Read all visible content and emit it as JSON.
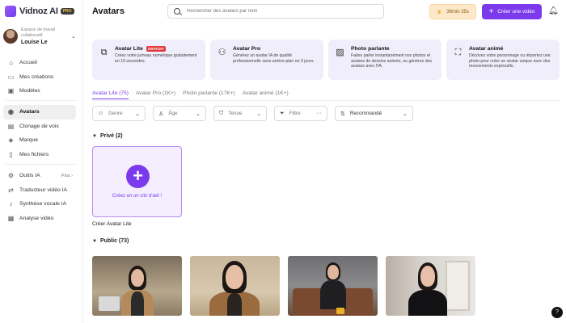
{
  "app": {
    "name": "Vidnoz AI",
    "pro_badge": "PRO"
  },
  "workspace": {
    "label": "Espace de travail collaboratif",
    "user": "Louise Le"
  },
  "sidebar": {
    "items": [
      {
        "label": "Accueil",
        "icon": "home-icon"
      },
      {
        "label": "Mes créations",
        "icon": "folder-icon"
      },
      {
        "label": "Modèles",
        "icon": "template-icon"
      },
      {
        "label": "Avatars",
        "icon": "avatar-icon",
        "active": true
      },
      {
        "label": "Clonage de voix",
        "icon": "voice-icon"
      },
      {
        "label": "Marque",
        "icon": "brand-icon"
      },
      {
        "label": "Mes fichiers",
        "icon": "file-icon"
      },
      {
        "label": "Outils IA",
        "icon": "tools-icon",
        "extra": "Plus"
      },
      {
        "label": "Traducteur vidéo IA",
        "icon": "translate-icon"
      },
      {
        "label": "Synthèse vocale IA",
        "icon": "tts-icon"
      },
      {
        "label": "Analyse vidéo",
        "icon": "analysis-icon"
      }
    ]
  },
  "header": {
    "title": "Avatars",
    "search_placeholder": "Rechercher des avatars par nom",
    "timer": "36min 35s",
    "create_label": "Créer une vidéo"
  },
  "cards": [
    {
      "title": "Avatar Lite",
      "badge": "GRATUIT",
      "desc": "Créez votre jumeau numérique gratuitement en 10 secondes.",
      "icon": "avatar-lite-icon"
    },
    {
      "title": "Avatar Pro",
      "badge": "",
      "desc": "Générez un avatar IA de qualité professionnelle sans arrière-plan en 3 jours.",
      "icon": "avatar-pro-icon"
    },
    {
      "title": "Photo parlante",
      "badge": "",
      "desc": "Faites parler instantanément vos photos et avatars de dessins animés, ou générez des avatars avec l'IA.",
      "icon": "photo-icon"
    },
    {
      "title": "Avatar animé",
      "badge": "",
      "desc": "Décrivez votre personnage ou importez une photo pour créer un avatar unique avec des mouvements expressifs.",
      "icon": "animated-icon"
    }
  ],
  "tabs": [
    {
      "label": "Avatar Lite (75)",
      "active": true
    },
    {
      "label": "Avatar Pro (1K+)"
    },
    {
      "label": "Photo parlante (17K+)"
    },
    {
      "label": "Avatar animé (1K+)"
    }
  ],
  "filters": {
    "genre": "Genre",
    "age": "Âge",
    "tenue": "Tenue",
    "filtre": "Filtre",
    "sort": "Recommandé"
  },
  "private_section": {
    "title": "Privé (2)",
    "create_text": "Créez en un clin d'œil !",
    "caption": "Créer Avatar Lite"
  },
  "public_section": {
    "title": "Public (73)"
  },
  "help_label": "?"
}
